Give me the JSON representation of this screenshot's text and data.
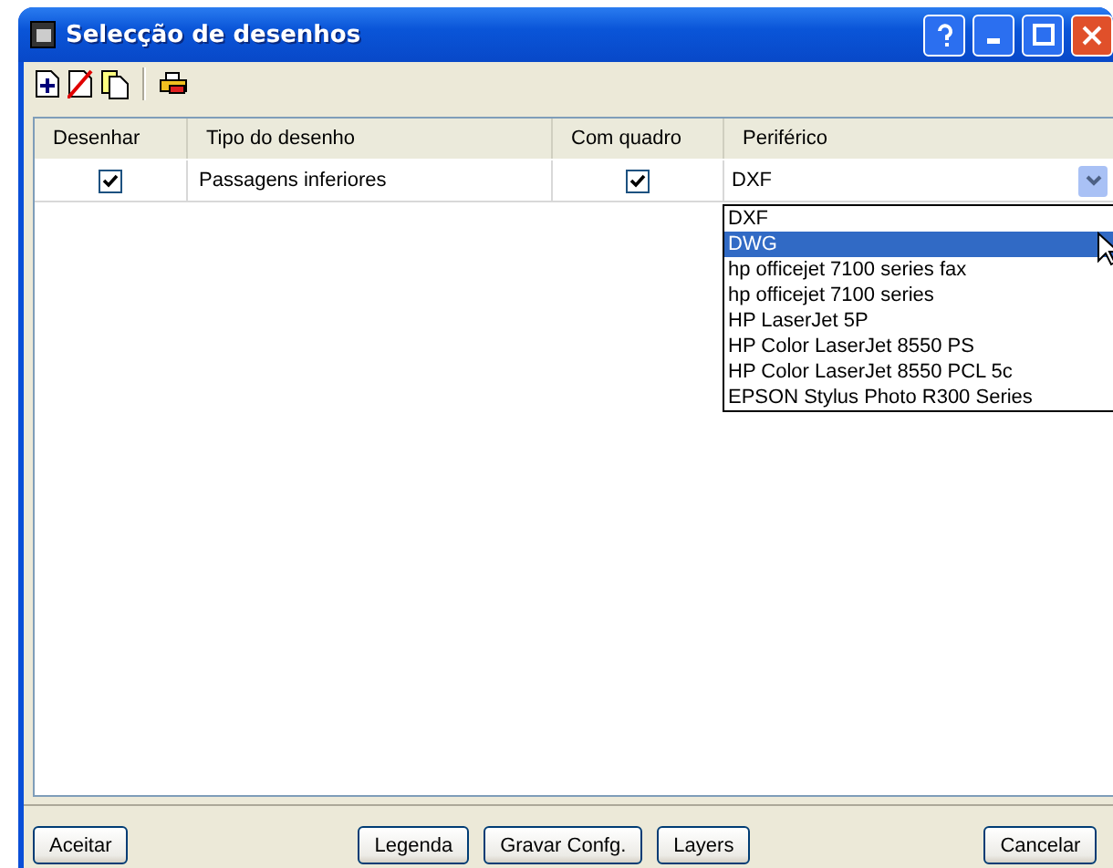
{
  "window": {
    "title": "Selecção de desenhos"
  },
  "table": {
    "columns": [
      "Desenhar",
      "Tipo do desenho",
      "Com quadro",
      "Periférico"
    ],
    "rows": [
      {
        "draw": true,
        "type": "Passagens inferiores",
        "with_frame": true,
        "peripheral": "DXF"
      }
    ]
  },
  "dropdown": {
    "expanded": true,
    "options": [
      {
        "label": "DXF",
        "selected": false
      },
      {
        "label": "DWG",
        "selected": true
      },
      {
        "label": "hp officejet 7100 series fax",
        "selected": false
      },
      {
        "label": "hp officejet 7100 series",
        "selected": false
      },
      {
        "label": "HP LaserJet 5P",
        "selected": false
      },
      {
        "label": "HP Color LaserJet 8550 PS",
        "selected": false
      },
      {
        "label": "HP Color LaserJet 8550 PCL 5c",
        "selected": false
      },
      {
        "label": "EPSON Stylus Photo R300 Series",
        "selected": false
      }
    ]
  },
  "buttons": {
    "left": [
      "Aceitar"
    ],
    "center": [
      "Legenda",
      "Gravar Confg.",
      "Layers"
    ],
    "right": [
      "Cancelar"
    ]
  }
}
